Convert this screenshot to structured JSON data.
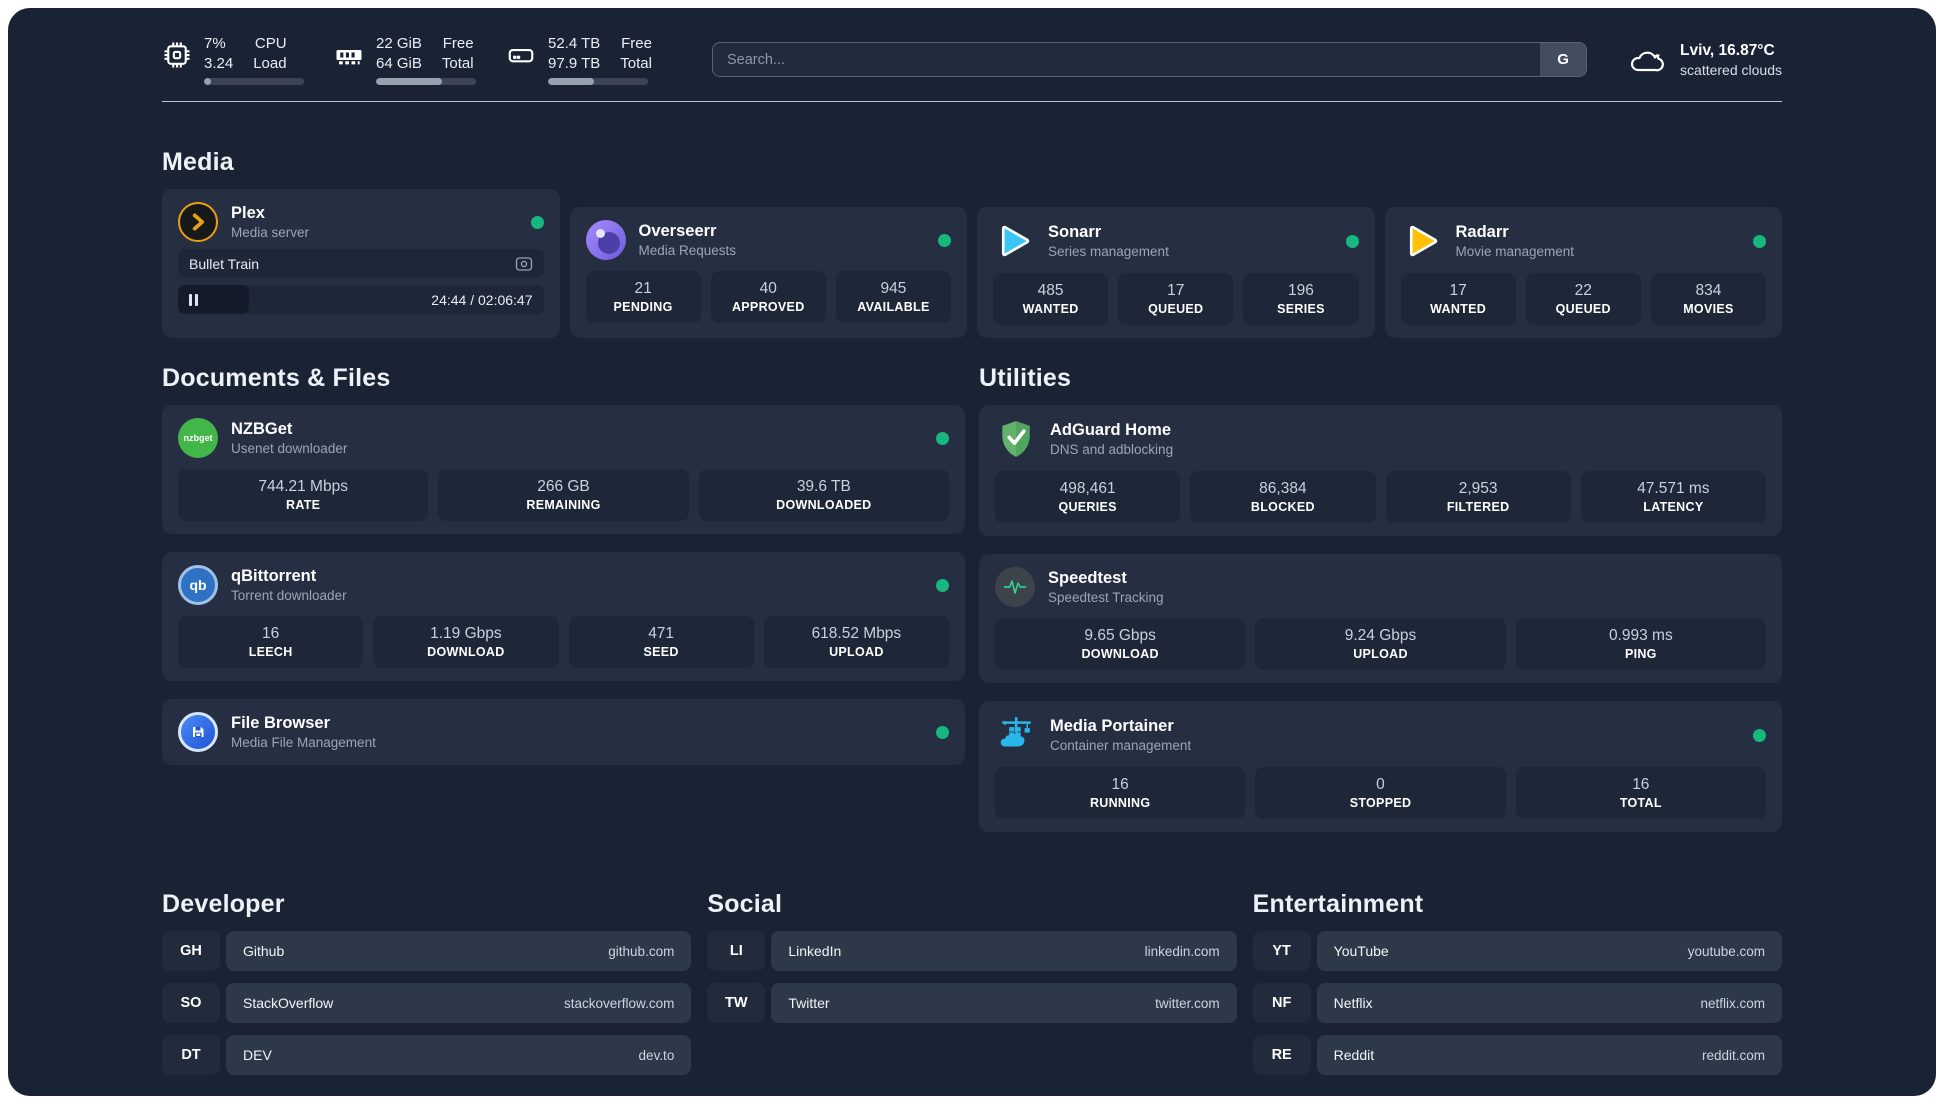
{
  "header": {
    "cpu": {
      "icon": "cpu-chip-icon",
      "value1": "7%",
      "value2": "3.24",
      "label1": "CPU",
      "label2": "Load",
      "progress_pct": 7
    },
    "memory": {
      "icon": "memory-icon",
      "value1": "22 GiB",
      "value2": "64 GiB",
      "label1": "Free",
      "label2": "Total",
      "progress_pct": 66
    },
    "disk": {
      "icon": "disk-icon",
      "value1": "52.4 TB",
      "value2": "97.9 TB",
      "label1": "Free",
      "label2": "Total",
      "progress_pct": 46
    },
    "search": {
      "placeholder": "Search...",
      "button_label": "G"
    },
    "weather": {
      "icon": "cloud-icon",
      "location": "Lviv, 16.87°C",
      "condition": "scattered clouds"
    }
  },
  "colors": {
    "status_online": "#16b880",
    "plex_accent": "#e7a012"
  },
  "media": {
    "title": "Media",
    "plex": {
      "name": "Plex",
      "subtitle": "Media server",
      "status": "online",
      "now_playing": "Bullet Train",
      "time": "24:44 / 02:06:47",
      "progress_pct": 19.5
    },
    "overseerr": {
      "name": "Overseerr",
      "subtitle": "Media Requests",
      "status": "online",
      "stats": [
        {
          "value": "21",
          "label": "PENDING"
        },
        {
          "value": "40",
          "label": "APPROVED"
        },
        {
          "value": "945",
          "label": "AVAILABLE"
        }
      ]
    },
    "sonarr": {
      "name": "Sonarr",
      "subtitle": "Series management",
      "status": "online",
      "stats": [
        {
          "value": "485",
          "label": "WANTED"
        },
        {
          "value": "17",
          "label": "QUEUED"
        },
        {
          "value": "196",
          "label": "SERIES"
        }
      ]
    },
    "radarr": {
      "name": "Radarr",
      "subtitle": "Movie management",
      "status": "online",
      "stats": [
        {
          "value": "17",
          "label": "WANTED"
        },
        {
          "value": "22",
          "label": "QUEUED"
        },
        {
          "value": "834",
          "label": "MOVIES"
        }
      ]
    }
  },
  "documents": {
    "title": "Documents & Files",
    "nzbget": {
      "name": "NZBGet",
      "subtitle": "Usenet downloader",
      "status": "online",
      "stats": [
        {
          "value": "744.21 Mbps",
          "label": "RATE"
        },
        {
          "value": "266 GB",
          "label": "REMAINING"
        },
        {
          "value": "39.6 TB",
          "label": "DOWNLOADED"
        }
      ]
    },
    "qbittorrent": {
      "name": "qBittorrent",
      "subtitle": "Torrent downloader",
      "status": "online",
      "stats": [
        {
          "value": "16",
          "label": "LEECH"
        },
        {
          "value": "1.19 Gbps",
          "label": "DOWNLOAD"
        },
        {
          "value": "471",
          "label": "SEED"
        },
        {
          "value": "618.52 Mbps",
          "label": "UPLOAD"
        }
      ]
    },
    "filebrowser": {
      "name": "File Browser",
      "subtitle": "Media File Management",
      "status": "online"
    }
  },
  "utilities": {
    "title": "Utilities",
    "adguard": {
      "name": "AdGuard Home",
      "subtitle": "DNS and adblocking",
      "stats": [
        {
          "value": "498,461",
          "label": "QUERIES"
        },
        {
          "value": "86,384",
          "label": "BLOCKED"
        },
        {
          "value": "2,953",
          "label": "FILTERED"
        },
        {
          "value": "47.571 ms",
          "label": "LATENCY"
        }
      ]
    },
    "speedtest": {
      "name": "Speedtest",
      "subtitle": "Speedtest Tracking",
      "stats": [
        {
          "value": "9.65 Gbps",
          "label": "DOWNLOAD"
        },
        {
          "value": "9.24 Gbps",
          "label": "UPLOAD"
        },
        {
          "value": "0.993 ms",
          "label": "PING"
        }
      ]
    },
    "portainer": {
      "name": "Media Portainer",
      "subtitle": "Container management",
      "status": "online",
      "stats": [
        {
          "value": "16",
          "label": "RUNNING"
        },
        {
          "value": "0",
          "label": "STOPPED"
        },
        {
          "value": "16",
          "label": "TOTAL"
        }
      ]
    }
  },
  "bookmarks": [
    {
      "title": "Developer",
      "links": [
        {
          "abbr": "GH",
          "name": "Github",
          "domain": "github.com"
        },
        {
          "abbr": "SO",
          "name": "StackOverflow",
          "domain": "stackoverflow.com"
        },
        {
          "abbr": "DT",
          "name": "DEV",
          "domain": "dev.to"
        }
      ]
    },
    {
      "title": "Social",
      "links": [
        {
          "abbr": "LI",
          "name": "LinkedIn",
          "domain": "linkedin.com"
        },
        {
          "abbr": "TW",
          "name": "Twitter",
          "domain": "twitter.com"
        }
      ]
    },
    {
      "title": "Entertainment",
      "links": [
        {
          "abbr": "YT",
          "name": "YouTube",
          "domain": "youtube.com"
        },
        {
          "abbr": "NF",
          "name": "Netflix",
          "domain": "netflix.com"
        },
        {
          "abbr": "RE",
          "name": "Reddit",
          "domain": "reddit.com"
        }
      ]
    }
  ]
}
